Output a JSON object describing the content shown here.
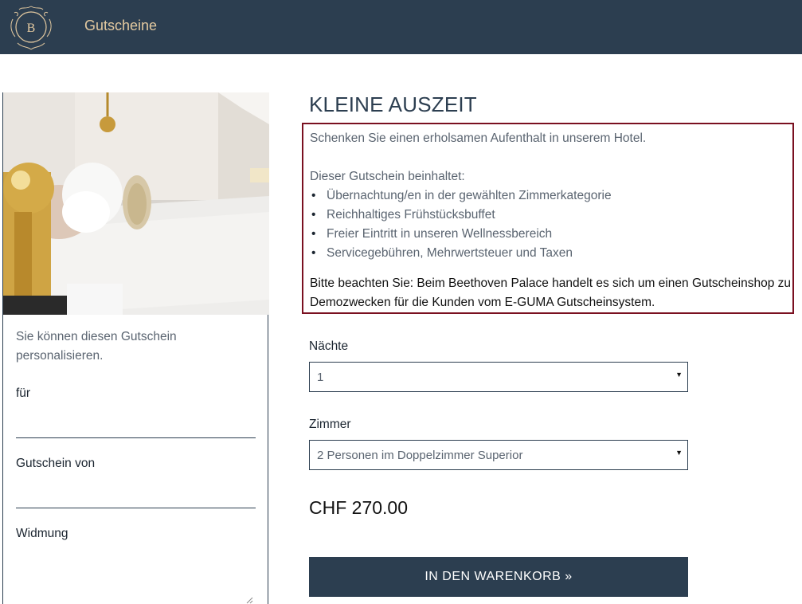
{
  "header": {
    "logo_letter": "B",
    "brand_link": "Gutscheine"
  },
  "colors": {
    "header_bg": "#2c3e50",
    "brand_gold": "#e3c9a0",
    "highlight_border": "#7a1020",
    "button_bg": "#2c3e50"
  },
  "personalization": {
    "intro": "Sie können diesen Gutschein personalisieren.",
    "for_label": "für",
    "for_value": "",
    "from_label": "Gutschein von",
    "from_value": "",
    "dedication_label": "Widmung",
    "dedication_value": ""
  },
  "product": {
    "title": "KLEINE AUSZEIT",
    "description": "Schenken Sie einen erholsamen Aufenthalt in unserem Hotel.",
    "includes_title": "Dieser Gutschein beinhaltet:",
    "includes": [
      "Übernachtung/en in der gewählten Zimmerkategorie",
      "Reichhaltiges Frühstücksbuffet",
      "Freier Eintritt in unseren Wellnessbereich",
      "Servicegebühren, Mehrwertsteuer und Taxen"
    ],
    "notice": "Bitte beachten Sie: Beim Beethoven Palace handelt es sich um einen Gutscheinshop zu Demozwecken für die Kunden vom E-GUMA Gutscheinsystem."
  },
  "options": {
    "nights_label": "Nächte",
    "nights_value": "1",
    "room_label": "Zimmer",
    "room_value": "2 Personen im Doppelzimmer Superior"
  },
  "price": "CHF 270.00",
  "cart_button": "IN DEN WARENKORB »"
}
